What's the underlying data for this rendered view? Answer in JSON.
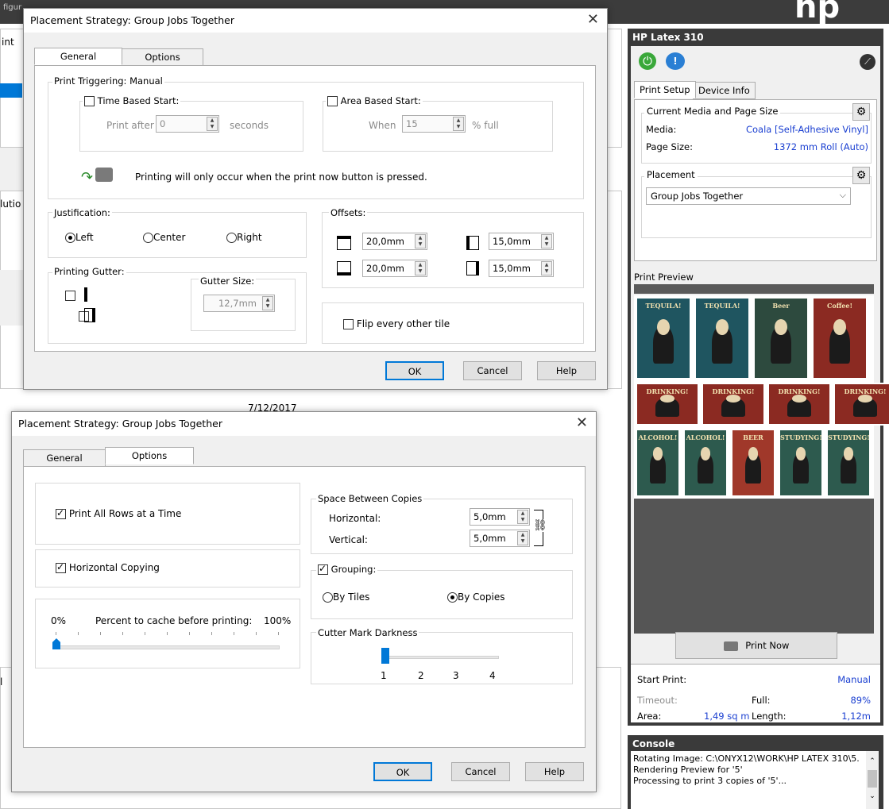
{
  "background_app": {
    "menu_fragment": "figur",
    "left_fragments": [
      "int",
      "lutio",
      "l"
    ],
    "date_fragment": "7/12/2017"
  },
  "hp_panel": {
    "title": "HP Latex 310",
    "icons": [
      "power-icon",
      "info-icon",
      "wrench-icon"
    ],
    "tabs": [
      "Print Setup",
      "Device Info"
    ],
    "media_group_label": "Current Media and Page Size",
    "media_label": "Media:",
    "media_value": "Coala [Self-Adhesive Vinyl]",
    "page_size_label": "Page Size:",
    "page_size_value": "1372 mm Roll (Auto)",
    "placement_label": "Placement",
    "placement_value": "Group Jobs Together",
    "print_preview_label": "Print Preview",
    "print_now_label": "Print Now",
    "start_print_label": "Start Print:",
    "start_print_value": "Manual",
    "timeout_label": "Timeout:",
    "full_label": "Full:",
    "full_value": "89%",
    "area_label": "Area:",
    "area_value": "1,49 sq m",
    "length_label": "Length:",
    "length_value": "1,12m",
    "accent_color": "#1a3fd1"
  },
  "thumbnails": {
    "row1": [
      {
        "title": "TEQUILA!",
        "color": "#1f5560"
      },
      {
        "title": "TEQUILA!",
        "color": "#1f5560"
      },
      {
        "title": "Beer",
        "color": "#2d4a3e"
      },
      {
        "title": "Coffee!",
        "color": "#8b2a22"
      }
    ],
    "row2": [
      {
        "title": "DRINKING!",
        "color": "#8b2a22"
      },
      {
        "title": "DRINKING!",
        "color": "#8b2a22"
      },
      {
        "title": "DRINKING!",
        "color": "#8b2a22"
      },
      {
        "title": "DRINKING!",
        "color": "#8b2a22"
      }
    ],
    "row3": [
      {
        "title": "ALCOHOL!",
        "color": "#2d5a4e"
      },
      {
        "title": "ALCOHOL!",
        "color": "#2d5a4e"
      },
      {
        "title": "BEER",
        "color": "#a0382a"
      },
      {
        "title": "STUDYING!",
        "color": "#2d5a4e"
      },
      {
        "title": "STUDYING!",
        "color": "#2d5a4e"
      }
    ]
  },
  "console": {
    "title": "Console",
    "lines": [
      "Rotating Image: C:\\ONYX12\\WORK\\HP LATEX 310\\5...",
      "Rendering Preview for '5'",
      "Processing to print 3 copies of '5'..."
    ]
  },
  "dialog1": {
    "title": "Placement Strategy: Group Jobs Together",
    "tabs": [
      "General",
      "Options"
    ],
    "print_triggering_label": "Print Triggering: Manual",
    "time_based_label": "Time Based Start:",
    "print_after_label": "Print after",
    "print_after_value": "0",
    "seconds_label": "seconds",
    "area_based_label": "Area Based Start:",
    "when_label": "When",
    "when_value": "15",
    "percent_full_label": "% full",
    "info_text": "Printing will only occur when the print now button is pressed.",
    "justification_label": "Justification:",
    "justification_options": [
      "Left",
      "Center",
      "Right"
    ],
    "justification_selected": "Left",
    "offsets_label": "Offsets:",
    "offset_top": "20,0mm",
    "offset_left": "15,0mm",
    "offset_bottom": "20,0mm",
    "offset_right": "15,0mm",
    "gutter_label": "Printing Gutter:",
    "gutter_size_label": "Gutter Size:",
    "gutter_size_value": "12,7mm",
    "flip_label": "Flip every other tile",
    "ok": "OK",
    "cancel": "Cancel",
    "help": "Help"
  },
  "dialog2": {
    "title": "Placement Strategy: Group Jobs Together",
    "tabs": [
      "General",
      "Options"
    ],
    "print_all_rows_label": "Print All Rows at a Time",
    "horizontal_copying_label": "Horizontal Copying",
    "cache_min": "0%",
    "cache_label": "Percent to cache before printing:",
    "cache_max": "100%",
    "cache_percent": 0,
    "space_label": "Space Between Copies",
    "horizontal_label": "Horizontal:",
    "horizontal_value": "5,0mm",
    "vertical_label": "Vertical:",
    "vertical_value": "5,0mm",
    "grouping_label": "Grouping:",
    "by_tiles_label": "By Tiles",
    "by_copies_label": "By Copies",
    "cutter_label": "Cutter Mark Darkness",
    "cutter_ticks": [
      "1",
      "2",
      "3",
      "4"
    ],
    "cutter_value": 1,
    "ok": "OK",
    "cancel": "Cancel",
    "help": "Help"
  }
}
